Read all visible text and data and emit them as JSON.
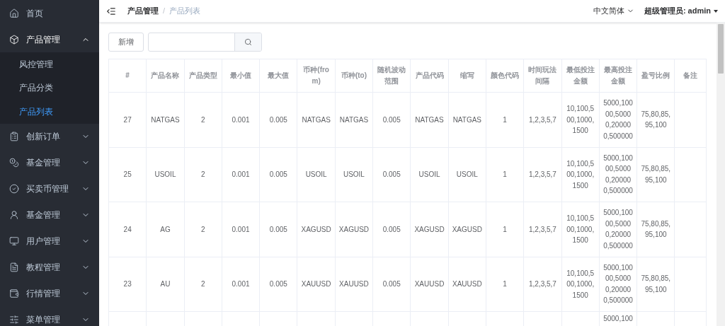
{
  "sidebar": {
    "items": [
      {
        "label": "首页"
      },
      {
        "label": "产品管理",
        "expanded": true,
        "children": [
          {
            "label": "风控管理",
            "selected": false
          },
          {
            "label": "产品分类",
            "selected": false
          },
          {
            "label": "产品列表",
            "selected": true
          }
        ]
      },
      {
        "label": "创新订单",
        "expanded": false
      },
      {
        "label": "基金管理",
        "expanded": false
      },
      {
        "label": "买卖币管理",
        "expanded": false
      },
      {
        "label": "基金管理",
        "expanded": false
      },
      {
        "label": "用户管理",
        "expanded": false
      },
      {
        "label": "教程管理",
        "expanded": false
      },
      {
        "label": "行情管理",
        "expanded": false
      },
      {
        "label": "菜单管理",
        "expanded": false
      }
    ]
  },
  "header": {
    "breadcrumb": [
      "产品管理",
      "产品列表"
    ],
    "separator": "/",
    "language": "中文简体",
    "user_label": "超级管理员:",
    "user_name": "admin"
  },
  "toolbar": {
    "add_button": "新增"
  },
  "table": {
    "columns": [
      "#",
      "产品名称",
      "产品类型",
      "最小值",
      "最大值",
      "币种(from)",
      "币种(to)",
      "随机波动范围",
      "产品代码",
      "缩写",
      "颜色代码",
      "时间玩法间隔",
      "最低投注金额",
      "最高投注金额",
      "盈亏比例",
      "备注"
    ],
    "rows": [
      [
        "27",
        "NATGAS",
        "2",
        "0.001",
        "0.005",
        "NATGAS",
        "NATGAS",
        "0.005",
        "NATGAS",
        "NATGAS",
        "1",
        "1,2,3,5,7",
        "10,100,500,1000,1500",
        "5000,10000,50000,200000,500000",
        "75,80,85,95,100",
        ""
      ],
      [
        "25",
        "USOIL",
        "2",
        "0.001",
        "0.005",
        "USOIL",
        "USOIL",
        "0.005",
        "USOIL",
        "USOIL",
        "1",
        "1,2,3,5,7",
        "10,100,500,1000,1500",
        "5000,10000,50000,200000,500000",
        "75,80,85,95,100",
        ""
      ],
      [
        "24",
        "AG",
        "2",
        "0.001",
        "0.005",
        "XAGUSD",
        "XAGUSD",
        "0.005",
        "XAGUSD",
        "XAGUSD",
        "1",
        "1,2,3,5,7",
        "10,100,500,1000,1500",
        "5000,10000,50000,200000,500000",
        "75,80,85,95,100",
        ""
      ],
      [
        "23",
        "AU",
        "2",
        "0.001",
        "0.005",
        "XAUUSD",
        "XAUUSD",
        "0.005",
        "XAUUSD",
        "XAUUSD",
        "1",
        "1,2,3,5,7",
        "10,100,500,1000,1500",
        "5000,10000,50000,200000,500000",
        "75,80,85,95,100",
        ""
      ]
    ],
    "partial_row": {
      "max_bet": "5000,100"
    }
  }
}
